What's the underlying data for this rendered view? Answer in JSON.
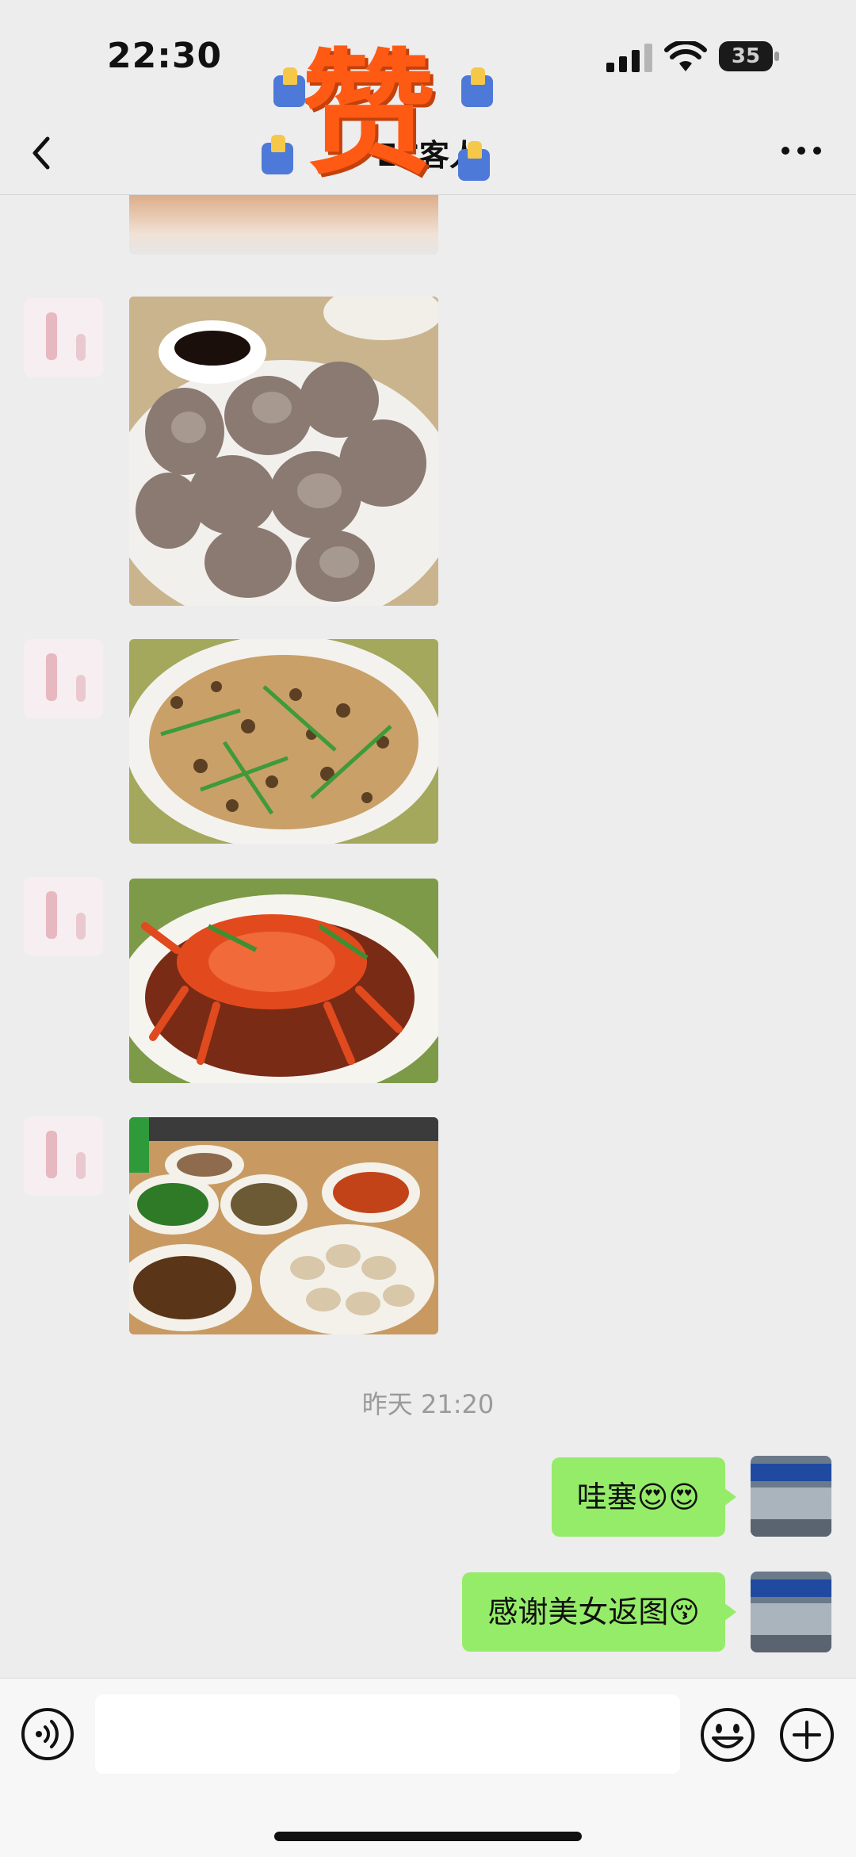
{
  "status_bar": {
    "time": "22:30",
    "battery": "35"
  },
  "nav": {
    "title": "EC客人",
    "sticker_text": "赞"
  },
  "chat": {
    "timestamp": "昨天 21:20",
    "photos": [
      "seafood-plate-1",
      "conch-plate",
      "spotted-snail-plate",
      "crab-plate",
      "seafood-table"
    ],
    "outgoing": [
      {
        "text": "哇塞",
        "emoji": "😍😍"
      },
      {
        "text": "感谢美女返图",
        "emoji": "😚"
      }
    ]
  },
  "icons": {
    "back": "chevron-left-icon",
    "more": "more-dots-icon",
    "voice": "voice-icon",
    "emoji": "emoji-icon",
    "plus": "plus-icon"
  },
  "colors": {
    "bubble": "#95EC69",
    "background": "#EDEDED",
    "sticker": "#FF5A14"
  }
}
